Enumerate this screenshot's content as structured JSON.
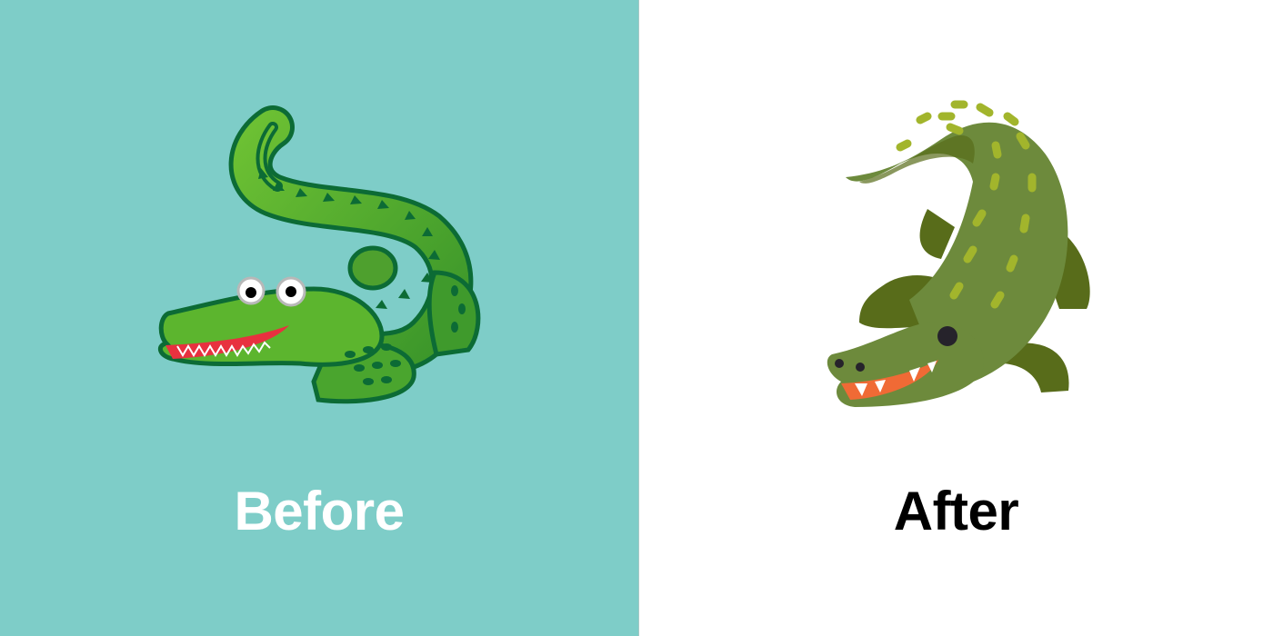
{
  "before": {
    "label": "Before",
    "background": "#7ecdc8",
    "icon": "crocodile-emoji-old"
  },
  "after": {
    "label": "After",
    "background": "#ffffff",
    "icon": "crocodile-emoji-new"
  },
  "colors": {
    "old_green": "#5cb52e",
    "old_outline": "#0c6b35",
    "new_green": "#6d8a3c",
    "new_dark": "#586c1a",
    "new_spots": "#a2b52c",
    "new_mouth": "#f06a35"
  }
}
